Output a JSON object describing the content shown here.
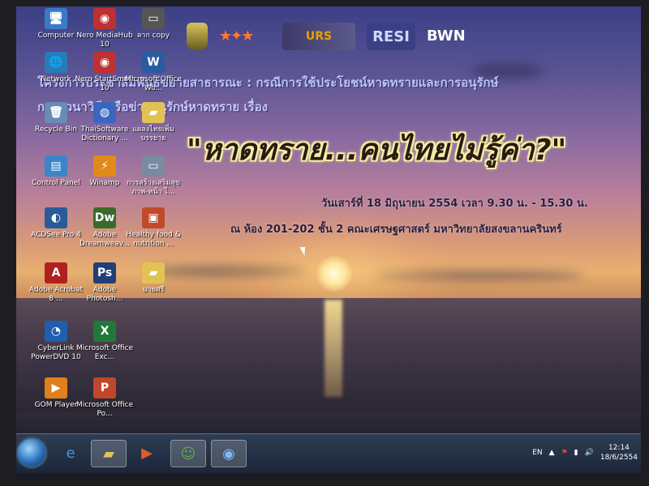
{
  "banner": {
    "logo_bwn": "BWN",
    "logo_urs": "URS",
    "logo_rt": "RESI",
    "line1": "โครงการประชาสัมพันธ์ขยายสาธารณะ : กรณีการใช้ประโยชน์หาดทรายและการอนุรักษ์",
    "line2": "การสวนาวิทีเครือข่ายอนุรักษ์หาดทราย เรื่อง",
    "headline": "\"หาดทราย...คนไทยไม่รู้ค่า?\"",
    "dateline": "วันเสาร์ที่ 18 มิถุนายน 2554 เวลา 9.30 น. - 15.30 น.",
    "venue": "ณ ห้อง 201-202 ชั้น 2 คณะเศรษฐศาสตร์ มหาวิทยาลัยสงขลานครินทร์"
  },
  "desktop_icons": [
    {
      "name": "computer-icon",
      "label": "Computer",
      "glyph": "🖥",
      "color": "#3a78c8"
    },
    {
      "name": "nero-mediahub-icon",
      "label": "Nero MediaHub 10",
      "glyph": "◉",
      "color": "#c03030"
    },
    {
      "name": "copy-icon",
      "label": "ลาก copy",
      "glyph": "▭",
      "color": "#555555"
    },
    {
      "name": "network-icon",
      "label": "Network",
      "glyph": "🌐",
      "color": "#2a7ab8"
    },
    {
      "name": "nero-startsmart-icon",
      "label": "Nero StartSmart 10",
      "glyph": "◉",
      "color": "#c03030"
    },
    {
      "name": "office-word-icon",
      "label": "Microsoft Office Wo...",
      "glyph": "W",
      "color": "#2c5aa0"
    },
    {
      "name": "recycle-bin-icon",
      "label": "Recycle Bin",
      "glyph": "🗑",
      "color": "#6a8ab8"
    },
    {
      "name": "thaisoftware-dictionary-icon",
      "label": "ThaiSoftware Dictionary ...",
      "glyph": "◍",
      "color": "#3a66c0"
    },
    {
      "name": "folder-icon",
      "label": "แผลงไทยเพิ่มบรรยาย",
      "glyph": "▰",
      "color": "#e2c255"
    },
    {
      "name": "control-panel-icon",
      "label": "Control Panel",
      "glyph": "▤",
      "color": "#3a86c8"
    },
    {
      "name": "winamp-icon",
      "label": "Winamp",
      "glyph": "⚡",
      "color": "#e08a1a"
    },
    {
      "name": "document-shortcut-icon",
      "label": "การสร้างเสริมสุขภาพ-หน้า ไ...",
      "glyph": "▭",
      "color": "#7a8aa0"
    },
    {
      "name": "acdsee-icon",
      "label": "ACDSee Pro 4",
      "glyph": "◐",
      "color": "#2a5a9a"
    },
    {
      "name": "dreamweaver-icon",
      "label": "Adobe Dreamweav...",
      "glyph": "Dw",
      "color": "#3a6a2a"
    },
    {
      "name": "healthy-food-icon",
      "label": "Healthy food & nutrition ...",
      "glyph": "▣",
      "color": "#c04a2a"
    },
    {
      "name": "acrobat-icon",
      "label": "Adobe Acrobat 8 ...",
      "glyph": "A",
      "color": "#b02020"
    },
    {
      "name": "photoshop-icon",
      "label": "Adobe Photosh...",
      "glyph": "Ps",
      "color": "#1f3f7a"
    },
    {
      "name": "folder-2-icon",
      "label": "นายศรี",
      "glyph": "▰",
      "color": "#e2c255"
    },
    {
      "name": "powerdvd-icon",
      "label": "CyberLink PowerDVD 10",
      "glyph": "◔",
      "color": "#1f5fb0"
    },
    {
      "name": "office-excel-icon",
      "label": "Microsoft Office Exc...",
      "glyph": "X",
      "color": "#1f7a3a"
    },
    {
      "name": "gom-player-icon",
      "label": "GOM Player",
      "glyph": "▶",
      "color": "#e0801a"
    },
    {
      "name": "office-powerpoint-icon",
      "label": "Microsoft Office Po...",
      "glyph": "P",
      "color": "#c0482a"
    }
  ],
  "taskbar": {
    "pinned": [
      {
        "name": "ie-taskbar-icon",
        "glyph": "e",
        "color": "#3a9ae8",
        "active": false
      },
      {
        "name": "explorer-taskbar-icon",
        "glyph": "▰",
        "color": "#e2c255",
        "active": true
      },
      {
        "name": "media-player-taskbar-icon",
        "glyph": "▶",
        "color": "#e05a2a",
        "active": false
      },
      {
        "name": "messenger-taskbar-icon",
        "glyph": "☺",
        "color": "#5ab04a",
        "active": true
      },
      {
        "name": "eye-taskbar-icon",
        "glyph": "◉",
        "color": "#7ab8ff",
        "active": true
      }
    ],
    "language": "EN",
    "time": "12:14",
    "date": "18/6/2554"
  }
}
